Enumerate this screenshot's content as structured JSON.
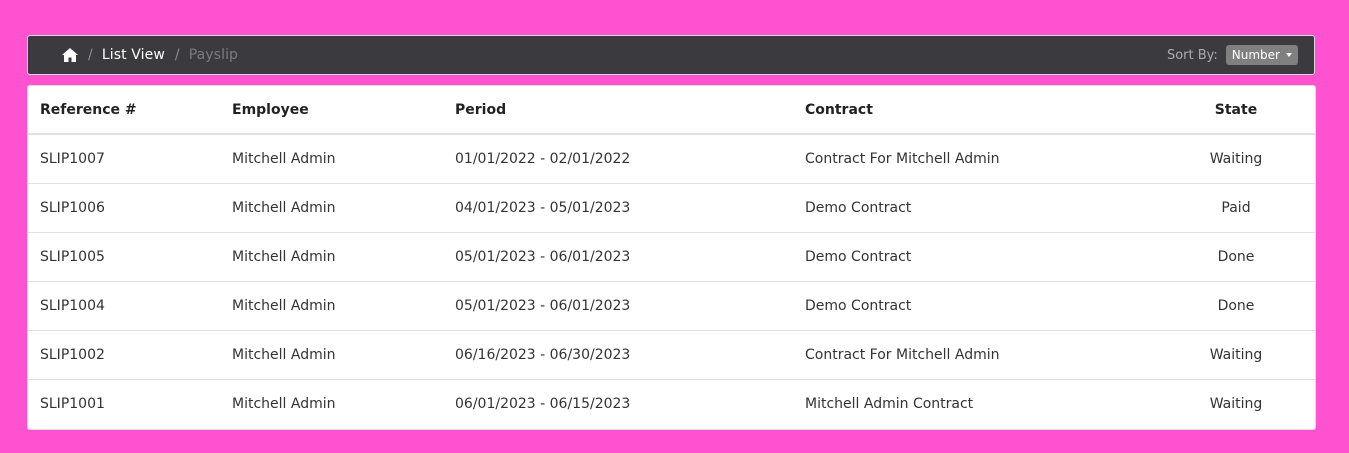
{
  "colors": {
    "page_background": "#ff52d0",
    "topbar_background": "#3a3a3f",
    "breadcrumb_text": "#ffffff",
    "breadcrumb_active": "#7a7a80",
    "separator": "#8a8a90",
    "sort_label": "#aaaaaf",
    "sort_button_bg": "#808080",
    "table_text": "#333333",
    "header_text": "#222222"
  },
  "breadcrumb": {
    "home_icon": "home-icon",
    "separator": "/",
    "items": [
      {
        "label": "List View"
      },
      {
        "label": "Payslip"
      }
    ]
  },
  "sort": {
    "label": "Sort By:",
    "selected": "Number",
    "icon": "caret-down-icon"
  },
  "table": {
    "headers": [
      "Reference #",
      "Employee",
      "Period",
      "Contract",
      "State"
    ],
    "rows": [
      {
        "reference": "SLIP1007",
        "employee": "Mitchell Admin",
        "period": "01/01/2022 - 02/01/2022",
        "contract": "Contract For Mitchell Admin",
        "state": "Waiting"
      },
      {
        "reference": "SLIP1006",
        "employee": "Mitchell Admin",
        "period": "04/01/2023 - 05/01/2023",
        "contract": "Demo Contract",
        "state": "Paid"
      },
      {
        "reference": "SLIP1005",
        "employee": "Mitchell Admin",
        "period": "05/01/2023 - 06/01/2023",
        "contract": "Demo Contract",
        "state": "Done"
      },
      {
        "reference": "SLIP1004",
        "employee": "Mitchell Admin",
        "period": "05/01/2023 - 06/01/2023",
        "contract": "Demo Contract",
        "state": "Done"
      },
      {
        "reference": "SLIP1002",
        "employee": "Mitchell Admin",
        "period": "06/16/2023 - 06/30/2023",
        "contract": "Contract For Mitchell Admin",
        "state": "Waiting"
      },
      {
        "reference": "SLIP1001",
        "employee": "Mitchell Admin",
        "period": "06/01/2023 - 06/15/2023",
        "contract": "Mitchell Admin Contract",
        "state": "Waiting"
      }
    ]
  }
}
